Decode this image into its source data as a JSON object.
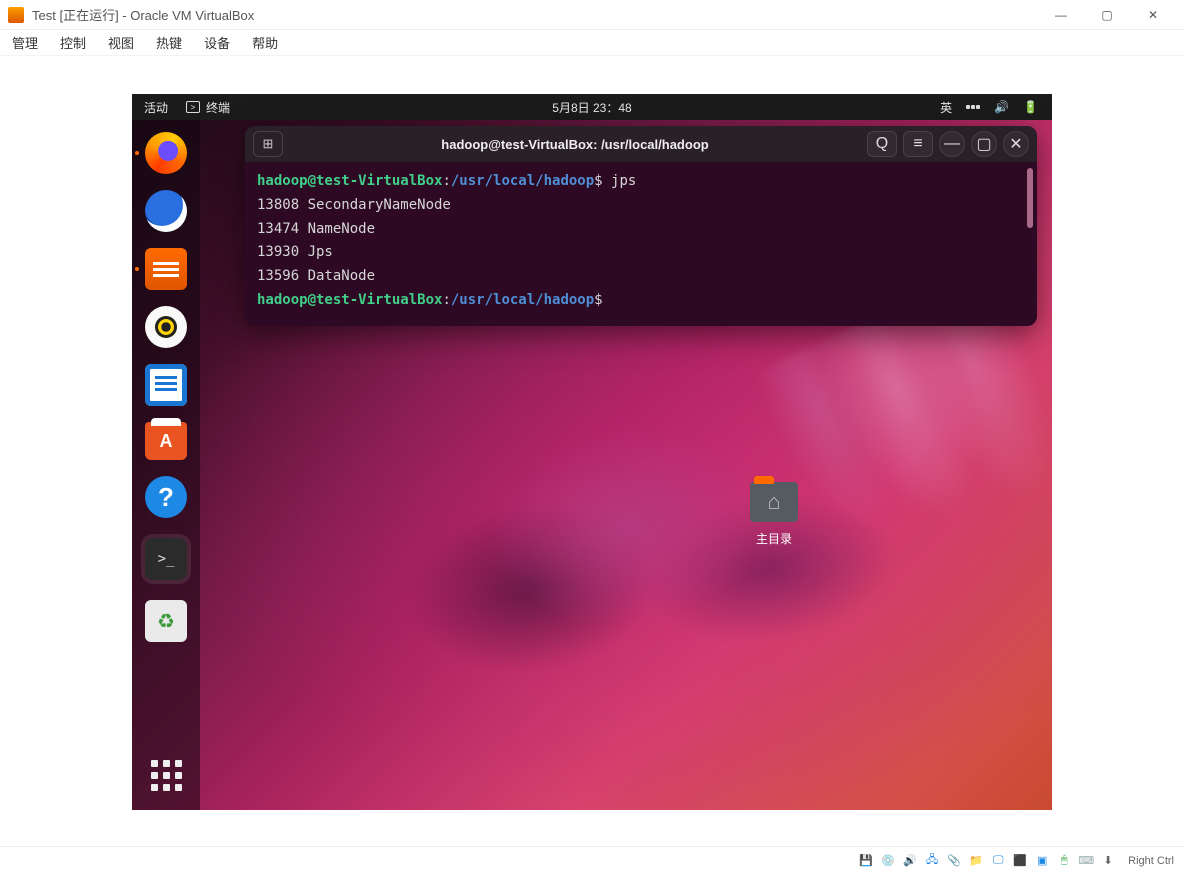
{
  "vbox": {
    "title": "Test [正在运行] - Oracle VM VirtualBox",
    "menu": {
      "manage": "管理",
      "control": "控制",
      "view": "视图",
      "hotkeys": "热键",
      "devices": "设备",
      "help": "帮助"
    },
    "host_key": "Right Ctrl",
    "host_key_icon": "⬇"
  },
  "ubuntu": {
    "activities": "活动",
    "app_indicator": "终端",
    "datetime": "5月8日 23：48",
    "ime": "英",
    "home_label": "主目录",
    "help_glyph": "?",
    "terminal_glyph": ">_"
  },
  "terminal": {
    "title": "hadoop@test-VirtualBox: /usr/local/hadoop",
    "new_tab_icon": "⊞",
    "search_icon": "Q",
    "menu_icon": "≡",
    "min_icon": "—",
    "max_icon": "▢",
    "close_icon": "✕",
    "prompt_user": "hadoop@test-VirtualBox",
    "prompt_sep": ":",
    "prompt_path": "/usr/local/hadoop",
    "prompt_dollar": "$",
    "cmd1": " jps",
    "out": [
      "13808 SecondaryNameNode",
      "13474 NameNode",
      "13930 Jps",
      "13596 DataNode"
    ]
  }
}
